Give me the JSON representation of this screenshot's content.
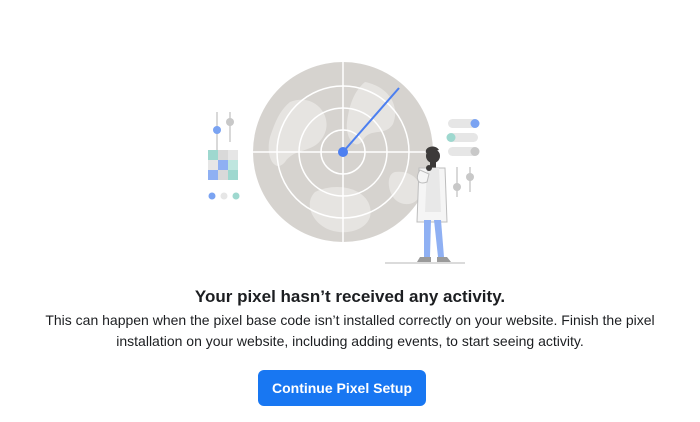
{
  "empty_state": {
    "illustration_icon": "radar-scientist-illustration",
    "title": "Your pixel hasn’t received any activity.",
    "description": "This can happen when the pixel base code isn’t installed correctly on your website. Finish the pixel installation on your website, including adding events, to start seeing activity.",
    "button_label": "Continue Pixel Setup"
  },
  "colors": {
    "primary_button": "#1877f2",
    "radar_fill": "#d6d3cf",
    "radar_accent": "#4c7ff0",
    "text": "#1c1e21"
  }
}
